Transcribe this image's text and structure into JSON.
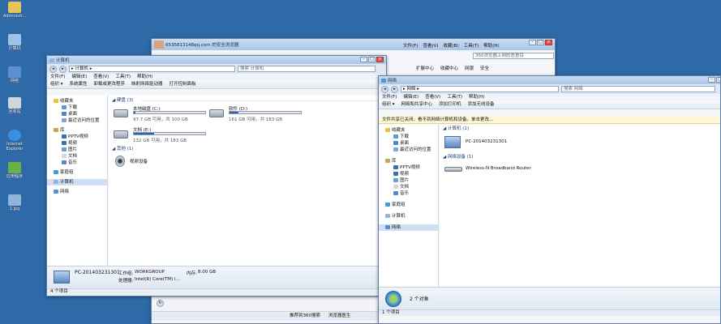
{
  "desktop": {
    "icons": [
      {
        "label": "Administr..."
      },
      {
        "label": "计算机"
      },
      {
        "label": "网络"
      },
      {
        "label": "回收站"
      },
      {
        "label": "Internet Explorer"
      },
      {
        "label": "应用程序"
      },
      {
        "label": "1.jpg"
      }
    ]
  },
  "browser": {
    "title": "6535813148qq.com 的安全浏览器",
    "menu": [
      "文件(F)",
      "查看(V)",
      "收藏(B)",
      "工具(T)",
      "帮助(H)"
    ],
    "search_placeholder": "360浏览器上网防恶意目",
    "toolbar": [
      "扩展中心",
      "收藏中心",
      "网银",
      "安全"
    ],
    "bottom_items": [
      "推荐到360搜索",
      "浏览器医生"
    ]
  },
  "computer_window": {
    "title": "计算机",
    "address": "▸ 计算机 ▸",
    "search_placeholder": "搜索 计算机",
    "menu": [
      "文件(F)",
      "编辑(E)",
      "查看(V)",
      "工具(T)",
      "帮助(H)"
    ],
    "toolbar": [
      "组织 ▾",
      "系统属性",
      "卸载或更改程序",
      "映射网络驱动器",
      "打开控制面板"
    ],
    "nav": {
      "favorites": "收藏夹",
      "fav_items": [
        "下载",
        "桌面",
        "最近访问的位置"
      ],
      "library": "库",
      "lib_items": [
        "PPTV视频",
        "视频",
        "图片",
        "文档",
        "音乐"
      ],
      "homegroup": "家庭组",
      "computer": "计算机",
      "network": "网络"
    },
    "group_disks": "硬盘 (3)",
    "disks": [
      {
        "name": "本地磁盘 (C:)",
        "info": "97.7 GB 可用，共 100 GB",
        "used": 0.02
      },
      {
        "name": "软件 (D:)",
        "info": "161 GB 可用，共 183 GB",
        "used": 0.12
      },
      {
        "name": "文档 (E:)",
        "info": "132 GB 可用，共 183 GB",
        "used": 0.28
      }
    ],
    "group_other": "其他 (1)",
    "other_item": "视频设备",
    "details": {
      "pc_name": "PC-201403231301",
      "workgroup_label": "工作组:",
      "workgroup": "WORKGROUP",
      "memory_label": "内存:",
      "memory": "8.00 GB",
      "cpu_label": "处理器:",
      "cpu": "Intel(R) Core(TM) i..."
    },
    "status": "4 个项目"
  },
  "network_window": {
    "title": "网络",
    "address": "▸ 网络 ▸",
    "search_placeholder": "搜索 网络",
    "menu": [
      "文件(F)",
      "编辑(E)",
      "查看(V)",
      "工具(T)",
      "帮助(H)"
    ],
    "toolbar": [
      "组织 ▾",
      "网络和共享中心",
      "添加打印机",
      "添加无线设备"
    ],
    "infobar": "文件共享已关闭。看不到网络计算机和设备。单击更改...",
    "nav": {
      "favorites": "收藏夹",
      "fav_items": [
        "下载",
        "桌面",
        "最近访问的位置"
      ],
      "library": "库",
      "lib_items": [
        "PPTV视频",
        "视频",
        "图片",
        "文档",
        "音乐"
      ],
      "homegroup": "家庭组",
      "computer": "计算机",
      "network": "网络"
    },
    "group_computers": "计算机 (1)",
    "computer_item": "PC-201403231301",
    "group_infra": "网络设备 (1)",
    "router_item": "Wireless-N Broadband Router",
    "details": "2 个对象",
    "status": "1 个项目"
  }
}
